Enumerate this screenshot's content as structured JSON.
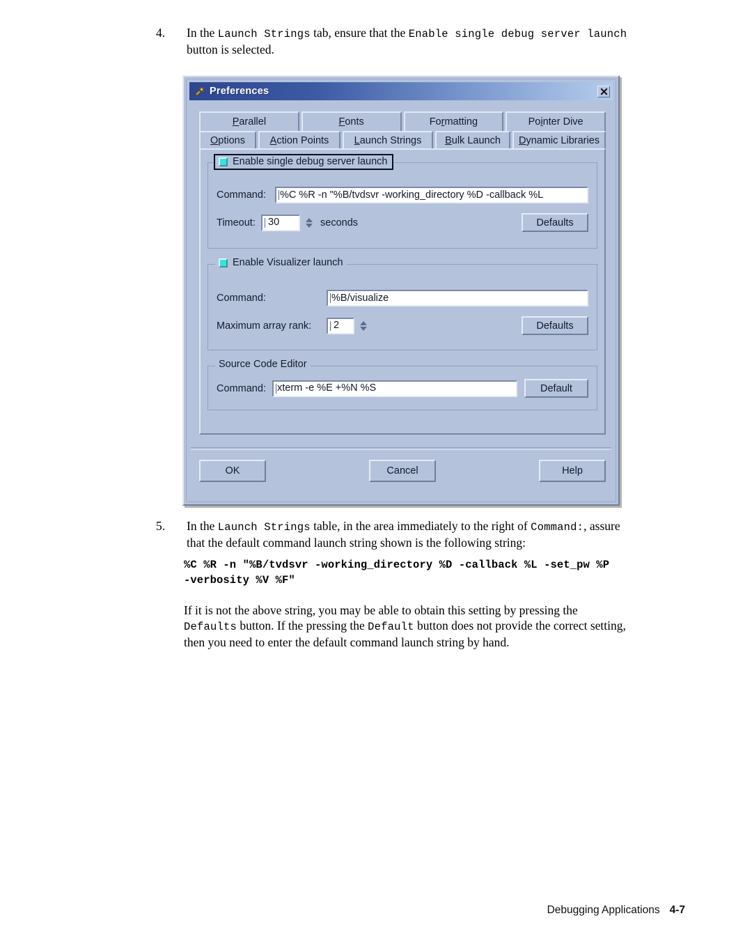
{
  "document": {
    "steps": [
      {
        "number": "4.",
        "segments": [
          {
            "t": "In the ",
            "m": false
          },
          {
            "t": "Launch Strings",
            "m": true
          },
          {
            "t": " tab, ensure that the ",
            "m": false
          },
          {
            "t": "Enable single debug server launch",
            "m": true
          },
          {
            "t": " button is selected.",
            "m": false
          }
        ]
      },
      {
        "number": "5.",
        "segments": [
          {
            "t": "In the ",
            "m": false
          },
          {
            "t": "Launch Strings",
            "m": true
          },
          {
            "t": " table, in the area immediately to the right of ",
            "m": false
          },
          {
            "t": "Command:",
            "m": true
          },
          {
            "t": ", assure that the default command launch string shown is the following string:",
            "m": false
          }
        ]
      }
    ],
    "code_block": "%C %R -n \"%B/tvdsvr -working_directory %D -callback %L -set_pw %P\n-verbosity %V %F\"",
    "closing_paragraph": [
      {
        "t": "If it is not the above string, you may be able to obtain this setting by pressing the ",
        "m": false
      },
      {
        "t": "Defaults",
        "m": true
      },
      {
        "t": " button. If the pressing the ",
        "m": false
      },
      {
        "t": "Default",
        "m": true
      },
      {
        "t": " button does not provide the correct setting, then you need to enter the default command launch string by hand.",
        "m": false
      }
    ],
    "footer": {
      "book_title": "Debugging Applications",
      "page_number": "4-7"
    }
  },
  "dialog": {
    "title": "Preferences",
    "close_label": "✖",
    "tabs_row1": [
      {
        "pre": "P",
        "mnemonic": "",
        "label": "Parallel",
        "mn_index": 0
      },
      {
        "label": "Fonts",
        "mn_index": 0
      },
      {
        "label": "Formatting",
        "mn_index": 2
      },
      {
        "label": "Pointer Dive",
        "mn_index": 2
      }
    ],
    "tabs_row2": [
      {
        "label": "Options",
        "mn_index": 0
      },
      {
        "label": "Action Points",
        "mn_index": 0
      },
      {
        "label": "Launch Strings",
        "mn_index": 0,
        "active": true
      },
      {
        "label": "Bulk Launch",
        "mn_index": 0
      },
      {
        "label": "Dynamic Libraries",
        "mn_index": 0
      }
    ],
    "groups": {
      "single_debug_server": {
        "checkbox_label": "Enable single debug server launch",
        "checked": true,
        "command_label": "Command:",
        "command_value": "%C %R -n \"%B/tvdsvr -working_directory %D -callback %L",
        "timeout_label": "Timeout:",
        "timeout_value": "30",
        "timeout_units": "seconds",
        "defaults_button": "Defaults"
      },
      "visualizer": {
        "checkbox_label": "Enable Visualizer launch",
        "checked": true,
        "command_label": "Command:",
        "command_value": "%B/visualize",
        "rank_label": "Maximum array rank:",
        "rank_value": "2",
        "defaults_button": "Defaults"
      },
      "source_code_editor": {
        "title": "Source Code Editor",
        "command_label": "Command:",
        "command_value": "xterm -e %E +%N %S",
        "default_button": "Default"
      }
    },
    "buttons": {
      "ok": "OK",
      "cancel": "Cancel",
      "help": "Help"
    },
    "colors": {
      "face": "#b4c2dc",
      "titlebar_start": "#2d4690",
      "titlebar_end": "#b4cdec",
      "checkbox_fill": "#2fe6dc",
      "field_bg": "#ffffff"
    }
  }
}
